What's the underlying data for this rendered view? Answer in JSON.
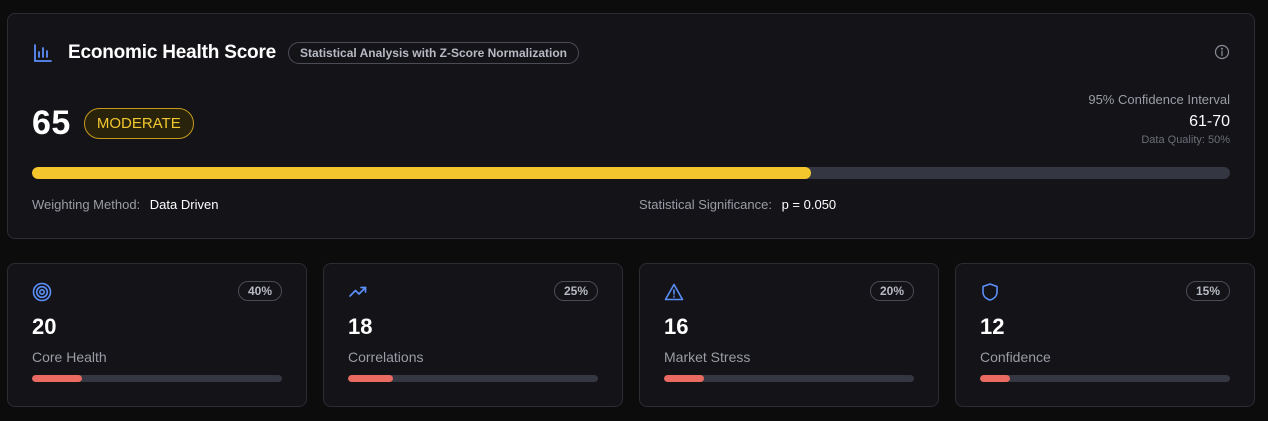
{
  "header": {
    "title": "Economic Health Score",
    "subtitle": "Statistical Analysis with Z-Score Normalization",
    "icon": "bar-chart-icon",
    "info_icon": "info-icon"
  },
  "score": {
    "value": "65",
    "status": "MODERATE",
    "progress_fraction": 0.65
  },
  "confidence": {
    "label": "95% Confidence Interval",
    "value": "61-70",
    "data_quality": "Data Quality: 50%"
  },
  "meta": {
    "weighting_label": "Weighting Method:",
    "weighting_value": "Data Driven",
    "significance_label": "Statistical Significance:",
    "significance_value": "p = 0.050"
  },
  "components": [
    {
      "icon": "target-icon",
      "weight": "40%",
      "value": "20",
      "label": "Core Health",
      "progress_fraction": 0.2
    },
    {
      "icon": "trending-up-icon",
      "weight": "25%",
      "value": "18",
      "label": "Correlations",
      "progress_fraction": 0.18
    },
    {
      "icon": "alert-triangle-icon",
      "weight": "20%",
      "value": "16",
      "label": "Market Stress",
      "progress_fraction": 0.16
    },
    {
      "icon": "shield-icon",
      "weight": "15%",
      "value": "12",
      "label": "Confidence",
      "progress_fraction": 0.12
    }
  ],
  "colors": {
    "accent_blue": "#5b8ff9",
    "moderate_yellow": "#f3c62d",
    "component_red": "#e86a61",
    "card_bg": "#131318",
    "page_bg": "#0c0c0d"
  }
}
